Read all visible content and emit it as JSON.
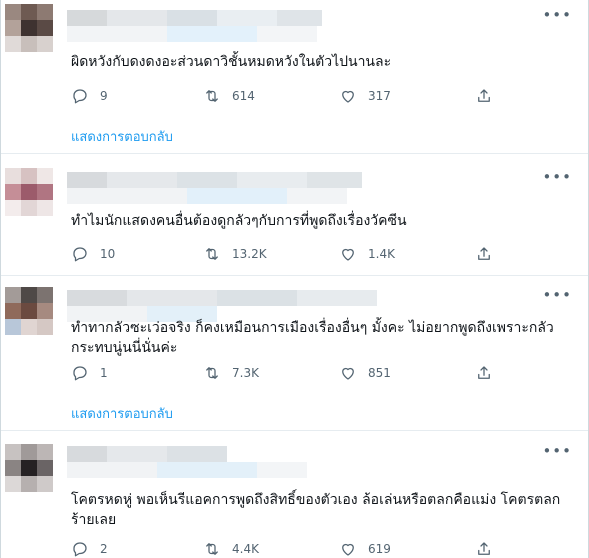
{
  "replies": [
    {
      "text": "ผิดหวังกับดงดงอะส่วนดาวิชั้นหมดหวังในตัวไปนานละ",
      "replies": "9",
      "retweets": "614",
      "likes": "317",
      "show_replies": "แสดงการตอบกลับ"
    },
    {
      "text": "ทำไมนักแสดงคนอื่นต้องดูกลัวๆกับการที่พูดถึงเรื่องวัคซีน",
      "replies": "10",
      "retweets": "13.2K",
      "likes": "1.4K",
      "show_replies": ""
    },
    {
      "text": "ทำทากลัวซะเว่อจริง ก็คงเหมือนการเมืองเรื่องอื่นๆ มั้งคะ ไม่อยากพูดถึงเพราะกลัว\nกระทบนู่นนี่นั่นค่ะ",
      "replies": "1",
      "retweets": "7.3K",
      "likes": "851",
      "show_replies": "แสดงการตอบกลับ"
    },
    {
      "text": "โคตรหดหู่ พอเห็นรีแอคการพูดถึงสิทธิ์ของตัวเอง ล้อเล่นหรือตลกคือแม่ง โคตรตลก\nร้ายเลย",
      "replies": "2",
      "retweets": "4.4K",
      "likes": "619",
      "show_replies": ""
    }
  ],
  "icons": {
    "reply": "reply-icon",
    "retweet": "retweet-icon",
    "like": "like-icon",
    "share": "share-icon",
    "more": "more-icon"
  },
  "colors": {
    "link": "#1d9bf0",
    "secondary_text": "#536471",
    "primary_text": "#0f1419",
    "divider": "#e6ecf0"
  }
}
